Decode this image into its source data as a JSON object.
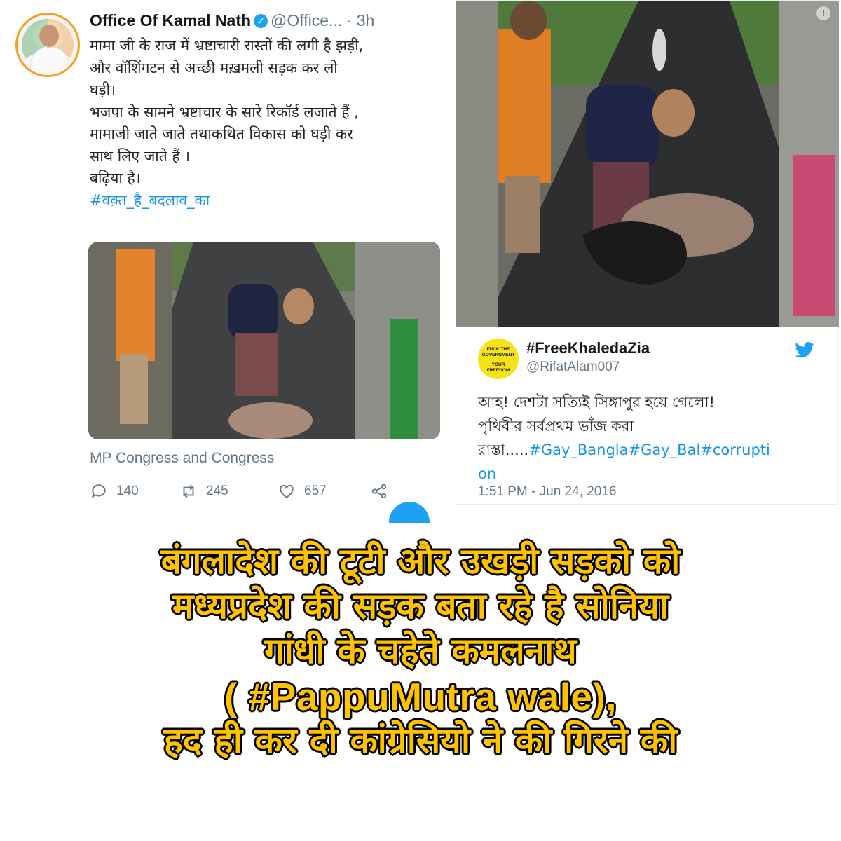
{
  "left_tweet": {
    "name": "Office Of Kamal Nath",
    "handle": "@Office...",
    "dot": "·",
    "time": "3h",
    "lines": [
      "मामा जी के राज में भ्रष्टाचारी रास्तों की लगी है झड़ी,",
      "और वॉशिंगटन से  अच्छी मख़मली सड़क कर लो",
      "घड़ी।",
      "भजपा के सामने भ्रष्टाचार के सारे रिकॉर्ड लजाते हैं ,",
      "मामाजी जाते जाते तथाकथित विकास को घड़ी कर",
      "साथ लिए जाते हैं ।",
      "बढ़िया है।"
    ],
    "hashtag": "#वक़्त_है_बदलाव_का",
    "source": "MP Congress and Congress",
    "replies": "140",
    "retweets": "245",
    "likes": "657"
  },
  "right_tweet": {
    "name": "#FreeKhaledaZia",
    "handle": "@RifatAlam007",
    "avatar_text": [
      "FUCK THE",
      "GOVERNMENT",
      "YOUR",
      "FREEDOM"
    ],
    "line1": "আহ! দেশটা সত্যিই সিঙ্গাপুর হয়ে গেলো!",
    "line2": "পৃথিবীর সর্বপ্রথম ভাঁজ করা",
    "line3_text": "রাস্তা.....",
    "line3_tags": "#Gay_Bangla#Gay_Bal#corrupti",
    "line4_tags": "on",
    "time": "1:51 PM - Jun 24, 2016"
  },
  "caption": {
    "line1": "बंगलादेश की टूटी और उखड़ी सड़को को",
    "line2": "मध्यप्रदेश की सड़क बता रहे है सोनिया",
    "line3": "गांधी के चहेते कमलनाथ",
    "line4": "( #PappuMutra wale),",
    "line5": "हद ही कर दी कांग्रेसियो ने की गिरने की"
  },
  "colors": {
    "twitter_blue": "#1da1f2",
    "link_blue": "#1b95e0",
    "muted_gray": "#657786",
    "caption_yellow": "#ffc200"
  }
}
